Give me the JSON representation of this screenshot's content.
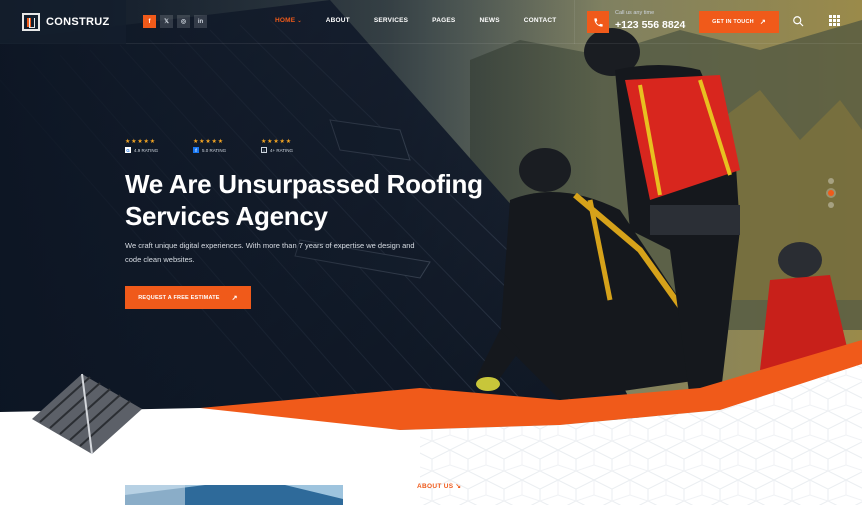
{
  "brand": {
    "name": "CONSTRUZ"
  },
  "socials": [
    {
      "icon": "facebook-icon",
      "glyph": "f"
    },
    {
      "icon": "x-icon",
      "glyph": "𝕏"
    },
    {
      "icon": "instagram-icon",
      "glyph": "◎"
    },
    {
      "icon": "linkedin-icon",
      "glyph": "in"
    }
  ],
  "nav": {
    "items": [
      "HOME",
      "ABOUT",
      "SERVICES",
      "PAGES",
      "NEWS",
      "CONTACT"
    ],
    "caret": "⌄"
  },
  "contact": {
    "label": "Call us any time",
    "number": "+123 556 8824"
  },
  "header": {
    "cta_label": "GET IN TOUCH",
    "cta_arrow": "↗"
  },
  "hero": {
    "ratings": [
      {
        "stars": "★★★★★",
        "badge": "G",
        "text": "4.9 RATING"
      },
      {
        "stars": "★★★★★",
        "badge": "f",
        "text": "5.0 RATING"
      },
      {
        "stars": "★★★★★",
        "badge": "⌂",
        "text": "4+ RATING"
      }
    ],
    "title": "We Are Unsurpassed Roofing Services Agency",
    "subtitle": "We craft unique digital experiences. With more than 7 years of expertise we design and code clean websites.",
    "cta_label": "REQUEST A FREE ESTIMATE",
    "cta_arrow": "↗"
  },
  "about": {
    "label": "ABOUT US",
    "arrow": "↘"
  },
  "colors": {
    "accent": "#f05a1a",
    "dark": "#16243a"
  }
}
